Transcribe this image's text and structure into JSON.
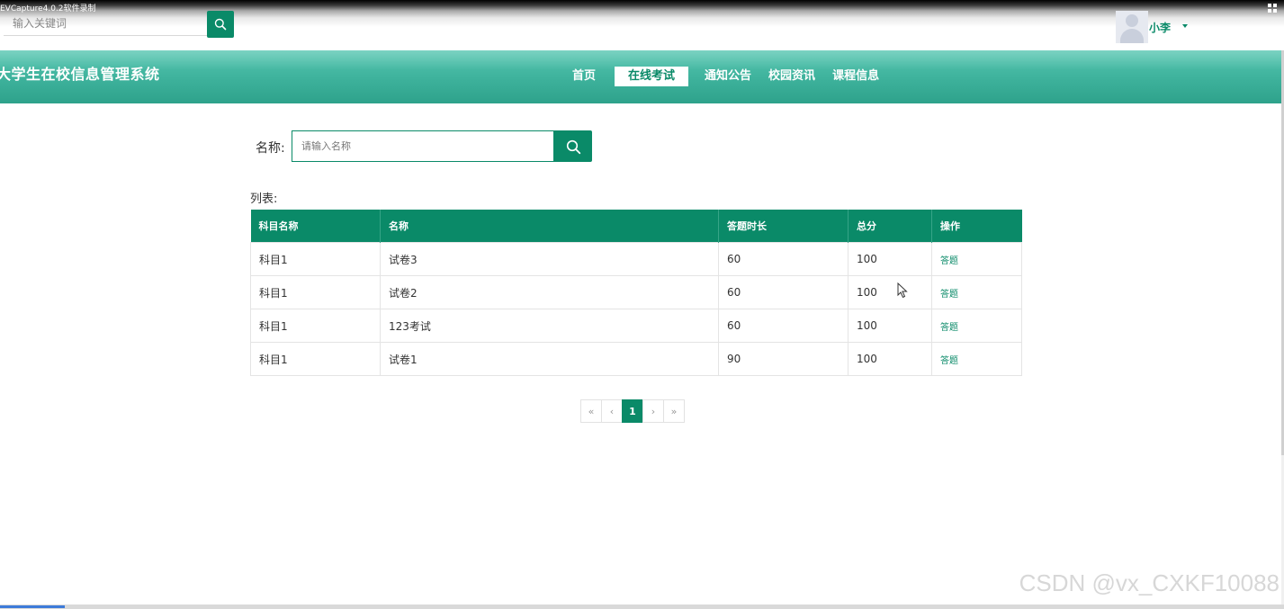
{
  "capture": {
    "title": "EVCapture4.0.2软件录制"
  },
  "top_search": {
    "placeholder": "输入关键词"
  },
  "user": {
    "name": "小李"
  },
  "header": {
    "site_title": "大学生在校信息管理系统",
    "nav": [
      {
        "label": "首页",
        "active": false
      },
      {
        "label": "在线考试",
        "active": true
      },
      {
        "label": "通知公告",
        "active": false
      },
      {
        "label": "校园资讯",
        "active": false
      },
      {
        "label": "课程信息",
        "active": false
      }
    ]
  },
  "search": {
    "label": "名称:",
    "placeholder": "请输入名称"
  },
  "list": {
    "label": "列表:",
    "columns": [
      "科目名称",
      "名称",
      "答题时长",
      "总分",
      "操作"
    ],
    "rows": [
      {
        "subject": "科目1",
        "name": "试卷3",
        "duration": "60",
        "score": "100",
        "action": "答题"
      },
      {
        "subject": "科目1",
        "name": "试卷2",
        "duration": "60",
        "score": "100",
        "action": "答题"
      },
      {
        "subject": "科目1",
        "name": "123考试",
        "duration": "60",
        "score": "100",
        "action": "答题"
      },
      {
        "subject": "科目1",
        "name": "试卷1",
        "duration": "90",
        "score": "100",
        "action": "答题"
      }
    ]
  },
  "pagination": {
    "first": "«",
    "prev": "‹",
    "current": "1",
    "next": "›",
    "last": "»"
  },
  "watermark": "CSDN @vx_CXKF10088",
  "colors": {
    "accent": "#0a8a68",
    "header_band": "#3fb39d"
  }
}
